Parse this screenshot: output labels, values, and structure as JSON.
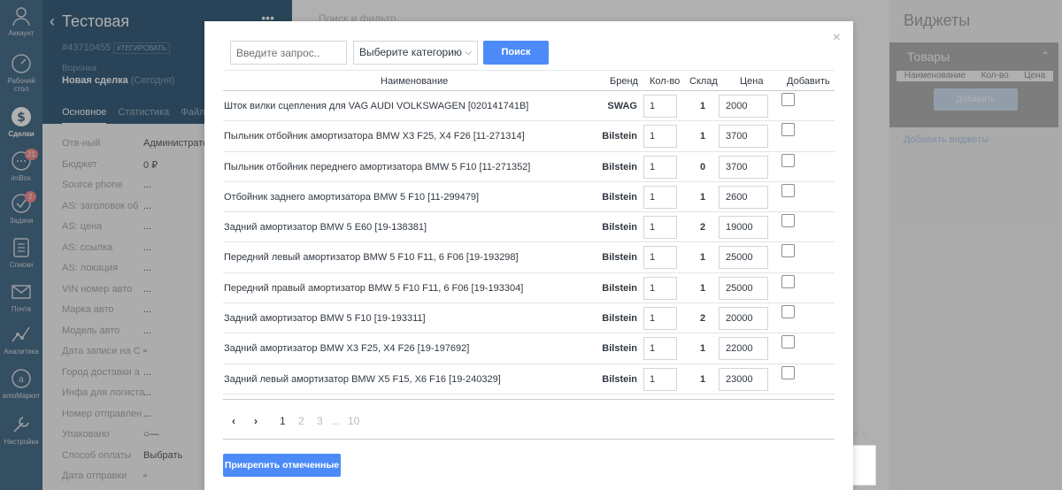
{
  "nav": {
    "items": [
      {
        "label": "Аккаунт",
        "icon": "user-icon"
      },
      {
        "label": "Рабочий стол",
        "icon": "dashboard-icon"
      },
      {
        "label": "Сделки",
        "icon": "deals-icon",
        "active": true
      },
      {
        "label": "imBox",
        "icon": "chat-icon",
        "badge": "21"
      },
      {
        "label": "Задачи",
        "icon": "tasks-icon",
        "badge": "2"
      },
      {
        "label": "Списки",
        "icon": "lists-icon"
      },
      {
        "label": "Почта",
        "icon": "mail-icon"
      },
      {
        "label": "Аналитика",
        "icon": "analytics-icon"
      },
      {
        "label": "amoМаркет",
        "icon": "market-icon"
      },
      {
        "label": "Настройки",
        "icon": "settings-icon"
      }
    ]
  },
  "lead": {
    "title": "Тестовая",
    "id": "#43710455",
    "tag": "#ТЕГИРОВАТЬ",
    "pipeline": "Воронка",
    "stage": "Новая сделка",
    "stage_date": "(Сегодня)",
    "tabs": [
      "Основное",
      "Статистика",
      "Файлы"
    ],
    "fields": [
      {
        "label": "Отв-ный",
        "value": "Администрато"
      },
      {
        "label": "Бюджет",
        "value": "0 ₽"
      },
      {
        "label": "Source phone",
        "value": "..."
      },
      {
        "label": "AS: заголовок об",
        "value": "..."
      },
      {
        "label": "AS: цена",
        "value": "..."
      },
      {
        "label": "AS: ссылка",
        "value": "..."
      },
      {
        "label": "AS: локация",
        "value": "..."
      },
      {
        "label": "VIN номер авто",
        "value": "..."
      },
      {
        "label": "Марка авто",
        "value": "..."
      },
      {
        "label": "Модель авто",
        "value": "..."
      },
      {
        "label": "Дата записи на С",
        "value": ""
      },
      {
        "label": "Город доставки а",
        "value": "..."
      },
      {
        "label": "Инфа для логиста",
        "value": "..."
      },
      {
        "label": "Номер отправлен",
        "value": "..."
      },
      {
        "label": "Упаковано",
        "value": ""
      },
      {
        "label": "Способ оплаты",
        "value": "Выбрать"
      },
      {
        "label": "Дата отправки",
        "value": ""
      }
    ]
  },
  "main": {
    "search_placeholder": "Поиск и фильтр"
  },
  "widgets": {
    "title": "Виджеты",
    "box_title": "Товары",
    "columns": [
      "Наименование",
      "Кол-во",
      "Цена"
    ],
    "add_button": "Добавить",
    "add_widgets_link": "Добавить виджеты"
  },
  "background_note": "и: 0",
  "modal": {
    "close": "×",
    "search_placeholder": "Введите запрос..",
    "category_value": "Выберите категорию",
    "search_button": "Поиск",
    "columns": [
      "Наименование",
      "Бренд",
      "Кол-во",
      "Склад",
      "Цена",
      "Добавить"
    ],
    "rows": [
      {
        "name": "Шток вилки сцепления для VAG AUDI VOLKSWAGEN [020141741B]",
        "brand": "SWAG",
        "qty": "1",
        "stock": "1",
        "price": "2000"
      },
      {
        "name": "Пыльник отбойник амортизатора BMW X3 F25, X4 F26 [11-271314]",
        "brand": "Bilstein",
        "qty": "1",
        "stock": "1",
        "price": "3700"
      },
      {
        "name": "Пыльник отбойник переднего амортизатора BMW 5 F10 [11-271352]",
        "brand": "Bilstein",
        "qty": "1",
        "stock": "0",
        "price": "3700"
      },
      {
        "name": "Отбойник заднего амортизатора BMW 5 F10 [11-299479]",
        "brand": "Bilstein",
        "qty": "1",
        "stock": "1",
        "price": "2600"
      },
      {
        "name": "Задний амортизатор BMW 5 E60 [19-138381]",
        "brand": "Bilstein",
        "qty": "1",
        "stock": "2",
        "price": "19000"
      },
      {
        "name": "Передний левый амортизатор BMW 5 F10 F11, 6 F06 [19-193298]",
        "brand": "Bilstein",
        "qty": "1",
        "stock": "1",
        "price": "25000"
      },
      {
        "name": "Передний правый амортизатор BMW 5 F10 F11, 6 F06 [19-193304]",
        "brand": "Bilstein",
        "qty": "1",
        "stock": "1",
        "price": "25000"
      },
      {
        "name": "Задний амортизатор BMW 5 F10 [19-193311]",
        "brand": "Bilstein",
        "qty": "1",
        "stock": "2",
        "price": "20000"
      },
      {
        "name": "Задний амортизатор BMW X3 F25, X4 F26 [19-197692]",
        "brand": "Bilstein",
        "qty": "1",
        "stock": "1",
        "price": "22000"
      },
      {
        "name": "Задний левый амортизатор BMW X5 F15, X6 F16 [19-240329]",
        "brand": "Bilstein",
        "qty": "1",
        "stock": "1",
        "price": "23000"
      }
    ],
    "pager": {
      "prev": "‹",
      "next": "›",
      "pages": [
        "1",
        "2",
        "3",
        "...",
        "10"
      ],
      "current": "1"
    },
    "attach_button": "Прикрепить отмеченные"
  }
}
